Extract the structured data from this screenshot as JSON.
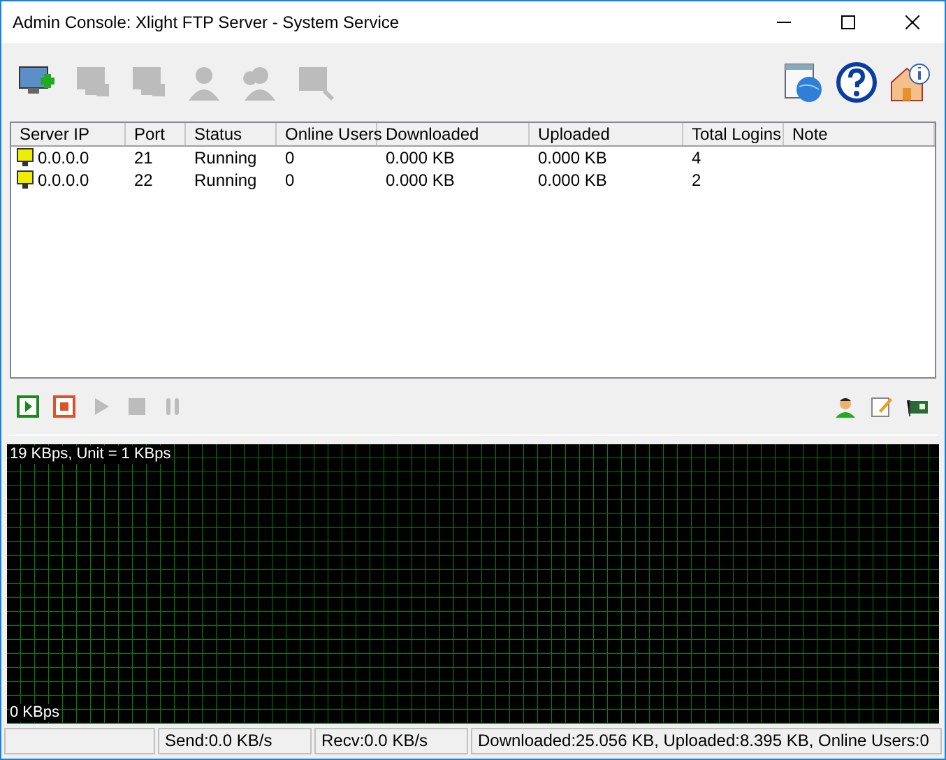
{
  "window": {
    "title": "Admin Console: Xlight FTP Server - System Service"
  },
  "toolbar": {
    "left": [
      {
        "kind": "add-server",
        "disabled": false
      },
      {
        "kind": "remove-server",
        "disabled": true
      },
      {
        "kind": "edit-server",
        "disabled": true
      },
      {
        "kind": "user",
        "disabled": true
      },
      {
        "kind": "users",
        "disabled": true
      },
      {
        "kind": "search",
        "disabled": true
      }
    ],
    "right": [
      {
        "kind": "web",
        "disabled": false
      },
      {
        "kind": "help",
        "disabled": false
      },
      {
        "kind": "about",
        "disabled": false
      }
    ]
  },
  "table": {
    "columns": [
      "Server IP",
      "Port",
      "Status",
      "Online Users",
      "Downloaded",
      "Uploaded",
      "Total Logins",
      "Note"
    ],
    "rows": [
      {
        "cells": [
          "0.0.0.0",
          "21",
          "Running",
          "0",
          "0.000 KB",
          "0.000 KB",
          "4"
        ]
      },
      {
        "cells": [
          "0.0.0.0",
          "22",
          "Running",
          "0",
          "0.000 KB",
          "0.000 KB",
          "2"
        ]
      }
    ]
  },
  "controls": {
    "left": [
      {
        "kind": "start",
        "disabled": false
      },
      {
        "kind": "stop",
        "disabled": false
      },
      {
        "kind": "play",
        "disabled": true
      },
      {
        "kind": "halt",
        "disabled": true
      },
      {
        "kind": "pause",
        "disabled": true
      }
    ],
    "right": [
      {
        "kind": "user",
        "disabled": false
      },
      {
        "kind": "edit",
        "disabled": false
      },
      {
        "kind": "card",
        "disabled": false
      }
    ]
  },
  "graph": {
    "top_label": "19 KBps, Unit = 1 KBps",
    "bottom_label": "0 KBps"
  },
  "status_bar": [
    "Send:0.0 KB/s",
    "Recv:0.0 KB/s",
    "Downloaded:25.056 KB, Uploaded:8.395 KB, Online Users:0"
  ]
}
